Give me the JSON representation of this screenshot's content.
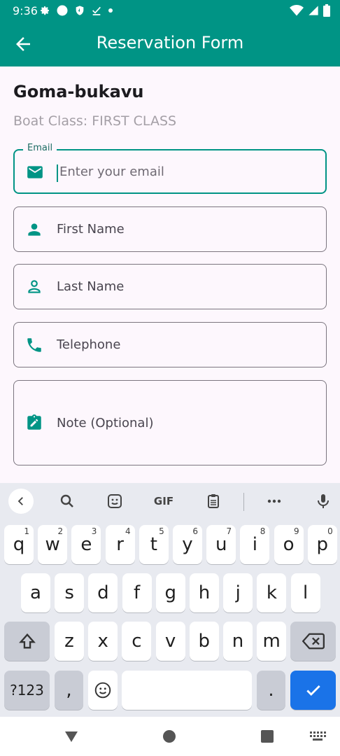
{
  "status_bar": {
    "time": "9:36"
  },
  "app_bar": {
    "title": "Reservation Form"
  },
  "trip": {
    "route": "Goma-bukavu",
    "boat_class": "Boat Class: FIRST CLASS"
  },
  "form": {
    "email": {
      "label": "Email",
      "placeholder": "Enter your email"
    },
    "first_name": {
      "placeholder": "First Name"
    },
    "last_name": {
      "placeholder": "Last Name"
    },
    "telephone": {
      "placeholder": "Telephone"
    },
    "note": {
      "placeholder": "Note (Optional)"
    }
  },
  "keyboard": {
    "suggestions": {
      "gif": "GIF"
    },
    "row1": [
      {
        "key": "q",
        "hint": "1"
      },
      {
        "key": "w",
        "hint": "2"
      },
      {
        "key": "e",
        "hint": "3"
      },
      {
        "key": "r",
        "hint": "4"
      },
      {
        "key": "t",
        "hint": "5"
      },
      {
        "key": "y",
        "hint": "6"
      },
      {
        "key": "u",
        "hint": "7"
      },
      {
        "key": "i",
        "hint": "8"
      },
      {
        "key": "o",
        "hint": "9"
      },
      {
        "key": "p",
        "hint": "0"
      }
    ],
    "row2": [
      "a",
      "s",
      "d",
      "f",
      "g",
      "h",
      "j",
      "k",
      "l"
    ],
    "row3": [
      "z",
      "x",
      "c",
      "v",
      "b",
      "n",
      "m"
    ],
    "row4": {
      "symbols": "?123",
      "comma": ",",
      "period": "."
    }
  },
  "colors": {
    "primary": "#009485",
    "accent_blue": "#1a73e8",
    "background": "#fdf7fd"
  }
}
